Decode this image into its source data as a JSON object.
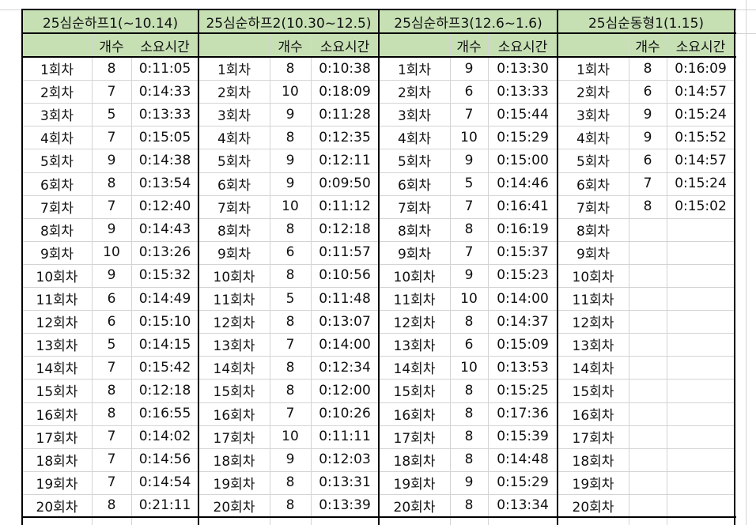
{
  "column_headers": [
    "개수",
    "소요시간"
  ],
  "row_labels": [
    "1회차",
    "2회차",
    "3회차",
    "4회차",
    "5회차",
    "6회차",
    "7회차",
    "8회차",
    "9회차",
    "10회차",
    "11회차",
    "12회차",
    "13회차",
    "14회차",
    "15회차",
    "16회차",
    "17회차",
    "18회차",
    "19회차",
    "20회차"
  ],
  "groups": [
    {
      "title": "25심순하프1(~10.14)",
      "counts": [
        "8",
        "7",
        "5",
        "7",
        "9",
        "8",
        "7",
        "9",
        "10",
        "9",
        "6",
        "6",
        "5",
        "7",
        "8",
        "8",
        "7",
        "7",
        "7",
        "8"
      ],
      "times": [
        "0:11:05",
        "0:14:33",
        "0:13:33",
        "0:15:05",
        "0:14:38",
        "0:13:54",
        "0:12:40",
        "0:14:43",
        "0:13:26",
        "0:15:32",
        "0:14:49",
        "0:15:10",
        "0:14:15",
        "0:15:42",
        "0:12:18",
        "0:16:55",
        "0:14:02",
        "0:14:56",
        "0:14:54",
        "0:21:11"
      ]
    },
    {
      "title": "25심순하프2(10.30~12.5)",
      "counts": [
        "8",
        "10",
        "9",
        "8",
        "9",
        "9",
        "10",
        "8",
        "6",
        "8",
        "5",
        "8",
        "7",
        "8",
        "8",
        "7",
        "10",
        "9",
        "8",
        "8"
      ],
      "times": [
        "0:10:38",
        "0:18:09",
        "0:11:28",
        "0:12:35",
        "0:12:11",
        "0:09:50",
        "0:11:12",
        "0:12:18",
        "0:11:57",
        "0:10:56",
        "0:11:48",
        "0:13:07",
        "0:14:00",
        "0:12:34",
        "0:12:00",
        "0:10:26",
        "0:11:11",
        "0:12:03",
        "0:13:31",
        "0:13:39"
      ]
    },
    {
      "title": "25심순하프3(12.6~1.6)",
      "counts": [
        "9",
        "6",
        "7",
        "10",
        "9",
        "5",
        "7",
        "8",
        "7",
        "9",
        "10",
        "8",
        "6",
        "10",
        "8",
        "8",
        "8",
        "8",
        "9",
        "8"
      ],
      "times": [
        "0:13:30",
        "0:13:33",
        "0:15:44",
        "0:15:29",
        "0:15:00",
        "0:14:46",
        "0:16:41",
        "0:16:19",
        "0:15:37",
        "0:15:23",
        "0:14:00",
        "0:14:37",
        "0:15:09",
        "0:13:53",
        "0:15:25",
        "0:17:36",
        "0:15:39",
        "0:14:48",
        "0:15:29",
        "0:13:34"
      ]
    },
    {
      "title": "25심순동형1(1.15)",
      "counts": [
        "8",
        "6",
        "9",
        "9",
        "6",
        "7",
        "8",
        "",
        "",
        "",
        "",
        "",
        "",
        "",
        "",
        "",
        "",
        "",
        "",
        ""
      ],
      "times": [
        "0:16:09",
        "0:14:57",
        "0:15:24",
        "0:15:52",
        "0:14:57",
        "0:15:24",
        "0:15:02",
        "",
        "",
        "",
        "",
        "",
        "",
        "",
        "",
        "",
        "",
        "",
        "",
        ""
      ]
    }
  ],
  "colors": {
    "header_fill": "#c6e0b4",
    "gridline": "#d4d4d4",
    "border": "#000000"
  }
}
